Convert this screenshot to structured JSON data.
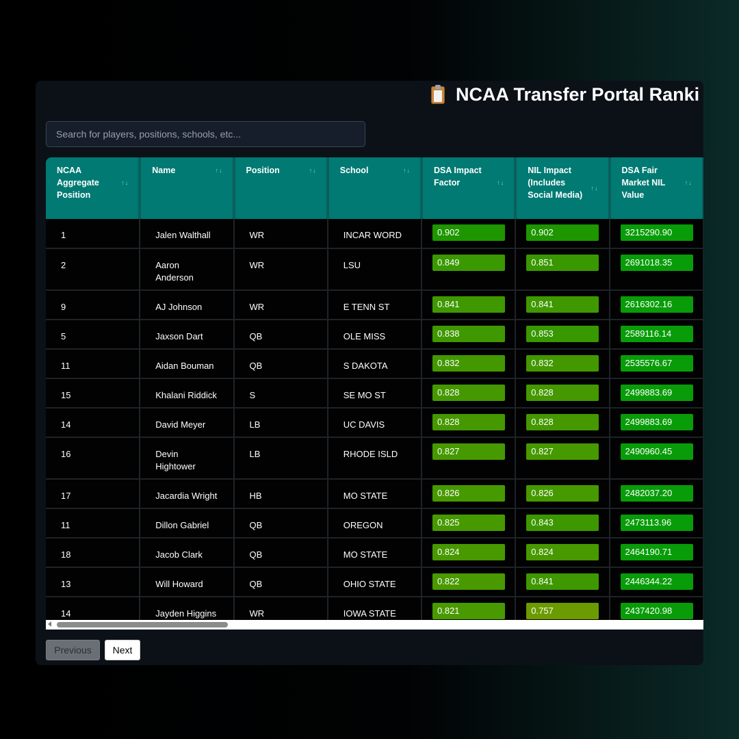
{
  "title": "NCAA Transfer Portal Ranki",
  "search": {
    "placeholder": "Search for players, positions, schools, etc..."
  },
  "columns": [
    "NCAA Aggregate Position",
    "Name",
    "Position",
    "School",
    "DSA Impact Factor",
    "NIL Impact (Includes Social Media)",
    "DSA Fair Market NIL Value"
  ],
  "sort_glyph": "↑↓",
  "rows": [
    {
      "rank": "1",
      "name": "Jalen Walthall",
      "position": "WR",
      "school": "INCAR WORD",
      "dsa": "0.902",
      "nil": "0.902",
      "value": "3215290.90"
    },
    {
      "rank": "2",
      "name": "Aaron Anderson",
      "position": "WR",
      "school": "LSU",
      "dsa": "0.849",
      "nil": "0.851",
      "value": "2691018.35"
    },
    {
      "rank": "9",
      "name": "AJ Johnson",
      "position": "WR",
      "school": "E TENN ST",
      "dsa": "0.841",
      "nil": "0.841",
      "value": "2616302.16"
    },
    {
      "rank": "5",
      "name": "Jaxson Dart",
      "position": "QB",
      "school": "OLE MISS",
      "dsa": "0.838",
      "nil": "0.853",
      "value": "2589116.14"
    },
    {
      "rank": "11",
      "name": "Aidan Bouman",
      "position": "QB",
      "school": "S DAKOTA",
      "dsa": "0.832",
      "nil": "0.832",
      "value": "2535576.67"
    },
    {
      "rank": "15",
      "name": "Khalani Riddick",
      "position": "S",
      "school": "SE MO ST",
      "dsa": "0.828",
      "nil": "0.828",
      "value": "2499883.69"
    },
    {
      "rank": "14",
      "name": "David Meyer",
      "position": "LB",
      "school": "UC DAVIS",
      "dsa": "0.828",
      "nil": "0.828",
      "value": "2499883.69"
    },
    {
      "rank": "16",
      "name": "Devin Hightower",
      "position": "LB",
      "school": "RHODE ISLD",
      "dsa": "0.827",
      "nil": "0.827",
      "value": "2490960.45"
    },
    {
      "rank": "17",
      "name": "Jacardia Wright",
      "position": "HB",
      "school": "MO STATE",
      "dsa": "0.826",
      "nil": "0.826",
      "value": "2482037.20"
    },
    {
      "rank": "11",
      "name": "Dillon Gabriel",
      "position": "QB",
      "school": "OREGON",
      "dsa": "0.825",
      "nil": "0.843",
      "value": "2473113.96"
    },
    {
      "rank": "18",
      "name": "Jacob Clark",
      "position": "QB",
      "school": "MO STATE",
      "dsa": "0.824",
      "nil": "0.824",
      "value": "2464190.71"
    },
    {
      "rank": "13",
      "name": "Will Howard",
      "position": "QB",
      "school": "OHIO STATE",
      "dsa": "0.822",
      "nil": "0.841",
      "value": "2446344.22"
    },
    {
      "rank": "14",
      "name": "Jayden Higgins",
      "position": "WR",
      "school": "IOWA STATE",
      "dsa": "0.821",
      "nil": "0.757",
      "value": "2437420.98"
    }
  ],
  "pagination": {
    "previous": "Previous",
    "next": "Next"
  }
}
